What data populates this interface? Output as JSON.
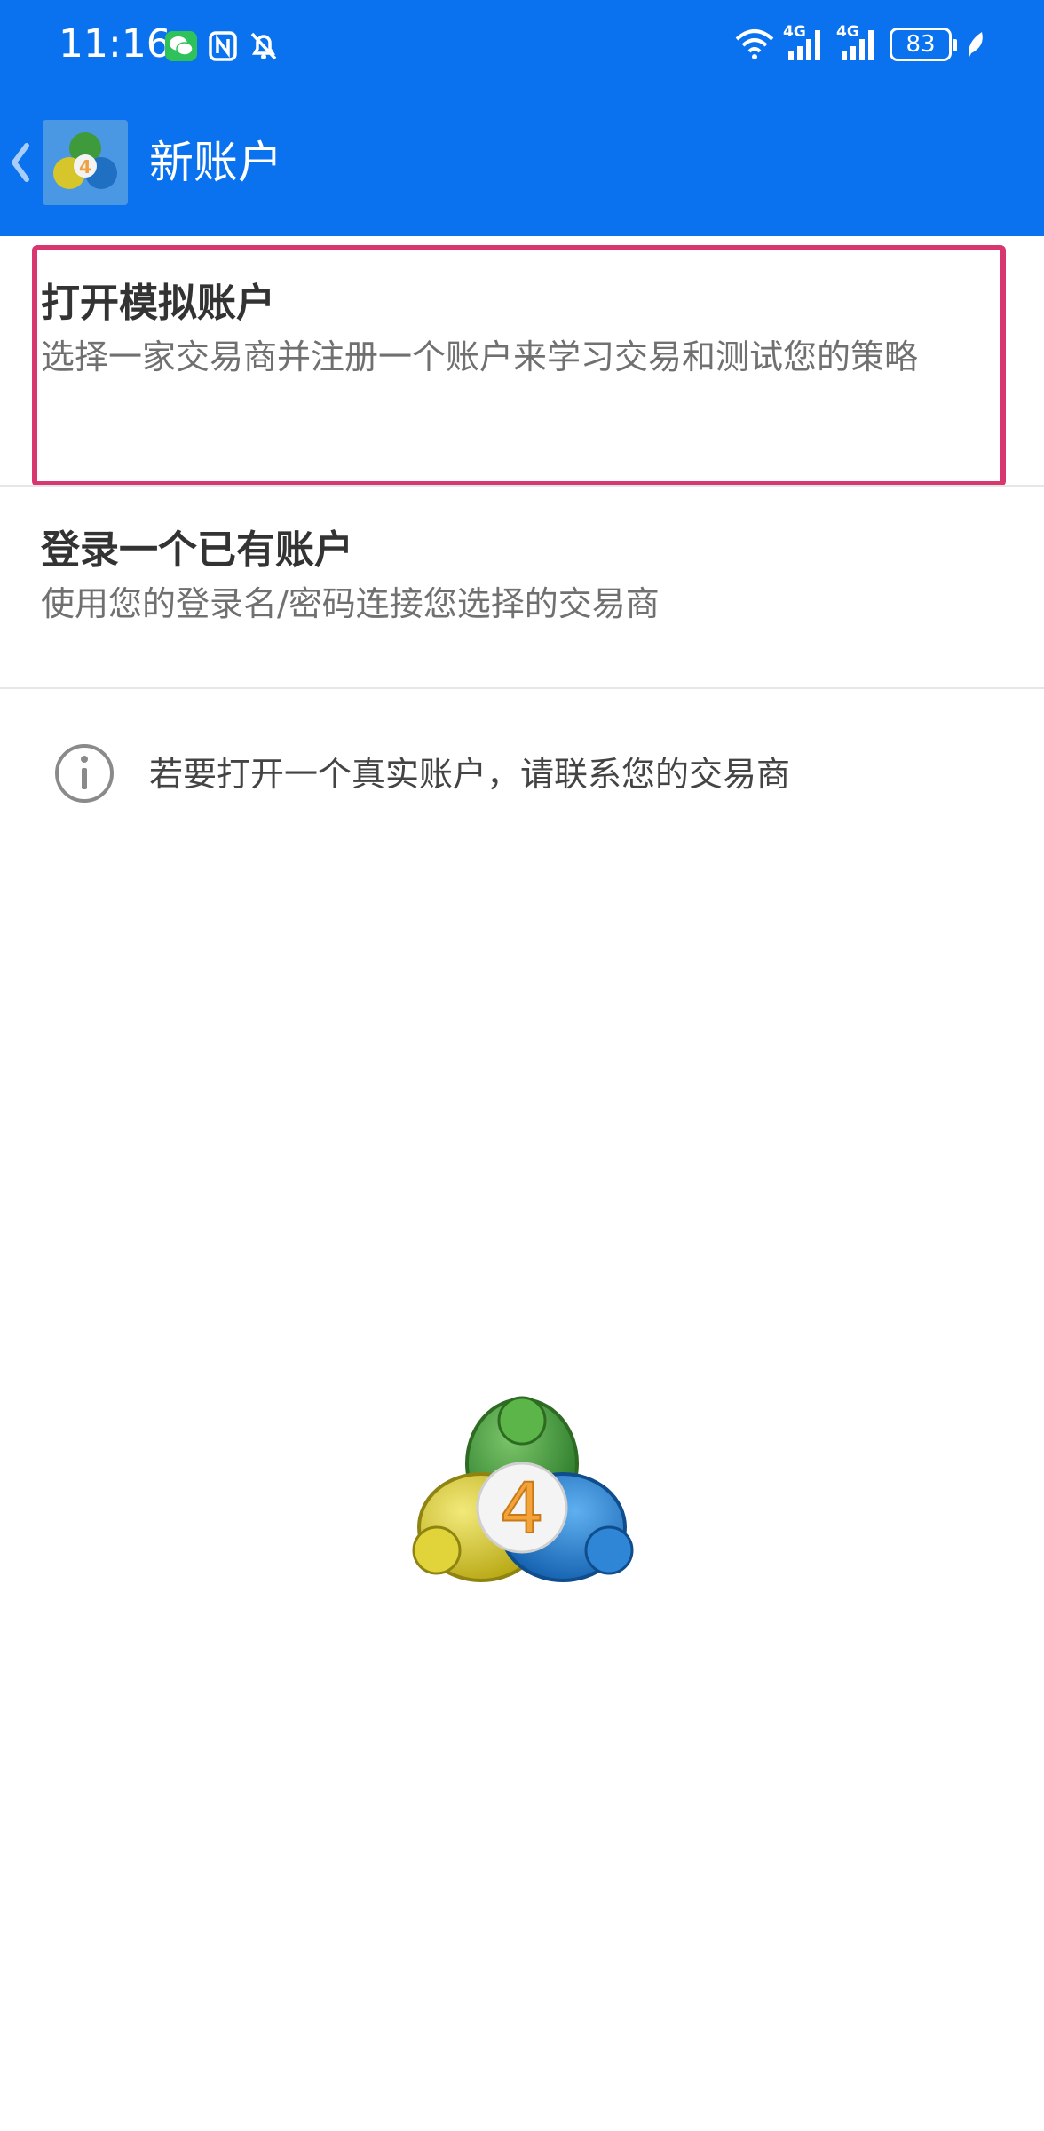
{
  "status_bar": {
    "time": "11:16",
    "left_icons": [
      "wechat-icon",
      "nfc-icon",
      "mute-notification-icon"
    ],
    "right_icons": [
      "wifi-icon",
      "signal-4g-icon",
      "signal-4g-icon",
      "battery-icon",
      "leaf-icon"
    ],
    "network_1": "4G",
    "network_2": "4G",
    "battery_level": "83"
  },
  "app_bar": {
    "title": "新账户",
    "background_color": "#0a72ef",
    "back_icon": "chevron-left-icon",
    "logo_icon": "metatrader4-logo-icon"
  },
  "menu": {
    "items": [
      {
        "title": "打开模拟账户",
        "subtitle": "选择一家交易商并注册一个账户来学习交易和测试您的策略",
        "highlighted": true,
        "highlight_color": "#d8366f"
      },
      {
        "title": "登录一个已有账户",
        "subtitle": "使用您的登录名/密码连接您选择的交易商",
        "highlighted": false
      }
    ]
  },
  "info": {
    "icon": "info-icon",
    "text": "若要打开一个真实账户，请联系您的交易商"
  },
  "footer_logo": {
    "icon": "metatrader4-logo-icon",
    "badge_text": "4"
  }
}
